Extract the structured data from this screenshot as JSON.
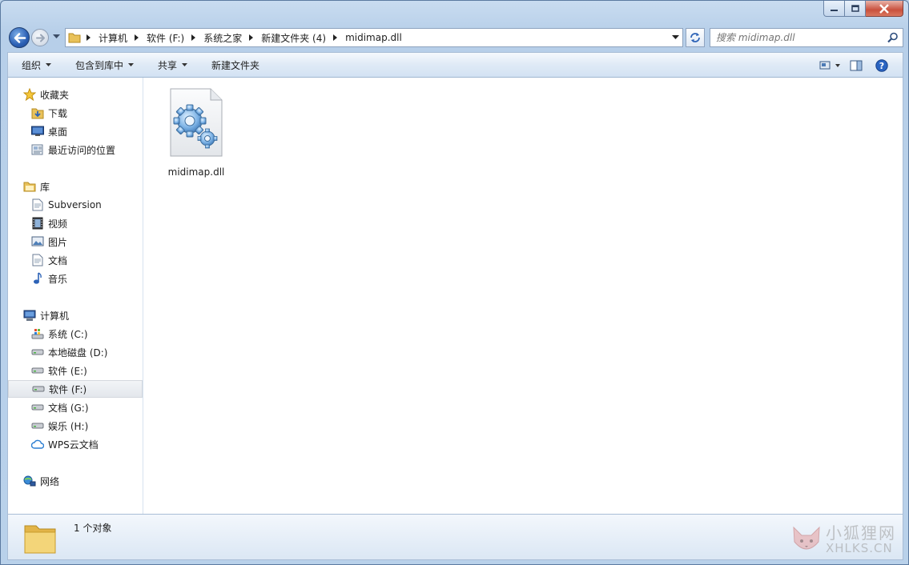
{
  "window": {
    "buttons": {
      "minimize": "minimize-icon",
      "maximize": "maximize-icon",
      "close": "close-icon"
    }
  },
  "navigation": {
    "breadcrumbs": [
      "计算机",
      "软件 (F:)",
      "系统之家",
      "新建文件夹 (4)",
      "midimap.dll"
    ],
    "search_placeholder": "搜索 midimap.dll"
  },
  "toolbar": {
    "organize": "组织",
    "include_in_library": "包含到库中",
    "share": "共享",
    "new_folder": "新建文件夹"
  },
  "sidebar": {
    "favorites": {
      "label": "收藏夹",
      "items": [
        "下载",
        "桌面",
        "最近访问的位置"
      ]
    },
    "libraries": {
      "label": "库",
      "items": [
        "Subversion",
        "视频",
        "图片",
        "文档",
        "音乐"
      ]
    },
    "computer": {
      "label": "计算机",
      "items": [
        "系统 (C:)",
        "本地磁盘 (D:)",
        "软件 (E:)",
        "软件 (F:)",
        "文档 (G:)",
        "娱乐 (H:)",
        "WPS云文档"
      ]
    },
    "network": {
      "label": "网络"
    },
    "selected": "软件 (F:)"
  },
  "files": [
    {
      "name": "midimap.dll",
      "icon": "dll-gear-icon"
    }
  ],
  "status": {
    "count": "1 个对象"
  },
  "watermark": {
    "line1": "小狐狸网",
    "line2": "XHLKS.CN"
  },
  "colors": {
    "accent": "#2a5fb4",
    "selection": "#e3e7ec"
  }
}
